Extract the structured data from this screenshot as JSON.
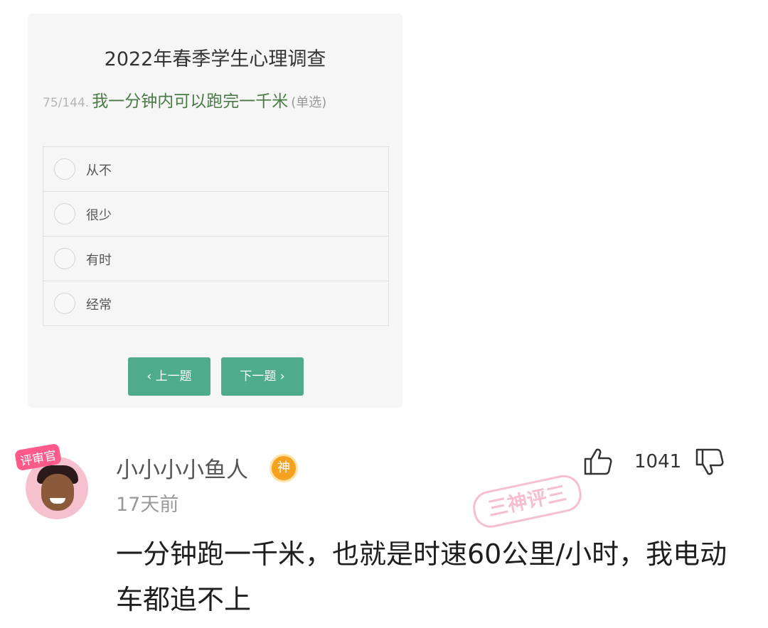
{
  "survey": {
    "title": "2022年春季学生心理调查",
    "question_number": "75/144.",
    "question_text": "我一分钟内可以跑完一千米",
    "question_type": "(单选)",
    "options": [
      "从不",
      "很少",
      "有时",
      "经常"
    ],
    "prev_button": "‹ 上一题",
    "next_button": "下一题 ›"
  },
  "comment": {
    "avatar_badge": "评审官",
    "username": "小小小小鱼人",
    "user_badge": "神",
    "timestamp": "17天前",
    "like_count": "1041",
    "stamp_text": "三神评三",
    "text": "一分钟跑一千米，也就是时速60公里/小时，我电动车都追不上",
    "icons": [
      "thumbs-up-icon",
      "thumbs-down-icon"
    ]
  },
  "colors": {
    "button": "#4eab8c",
    "question_text": "#4a7a45",
    "stamp": "#e84a7a",
    "badge": "#f4a21f"
  }
}
